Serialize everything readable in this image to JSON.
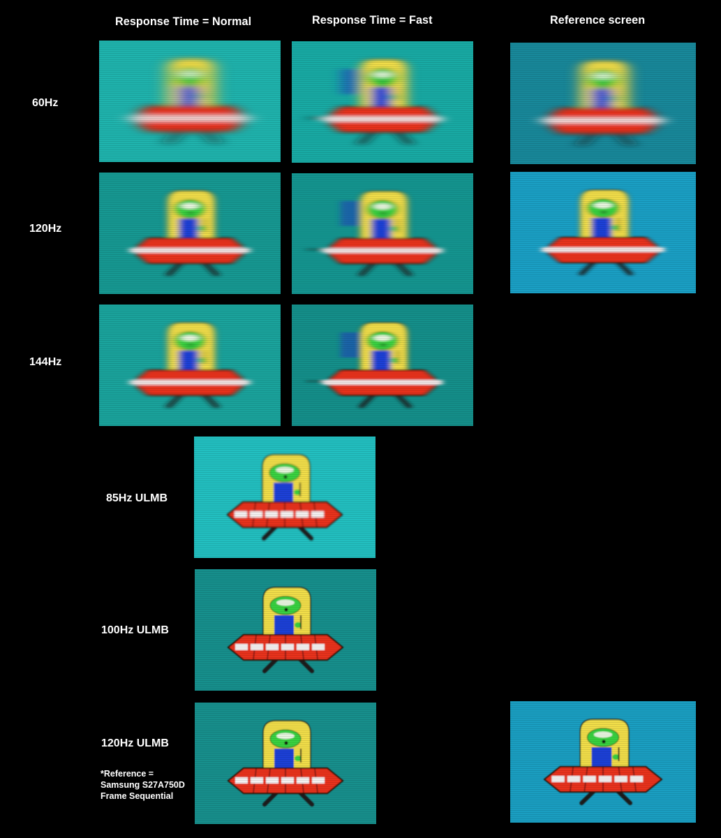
{
  "column_headers": [
    "Response Time = Normal",
    "Response Time = Fast",
    "Reference screen"
  ],
  "row_labels": {
    "hz60": "60Hz",
    "hz120": "120Hz",
    "hz144": "144Hz",
    "ulmb85": "85Hz ULMB",
    "ulmb100": "100Hz ULMB",
    "ulmb120": "120Hz ULMB"
  },
  "footnote": {
    "line1": "*Reference =",
    "line2": "Samsung S27A750D",
    "line3": "Frame Sequential"
  },
  "photos": [
    {
      "id": "60hz-normal",
      "subject": "ufo-alien",
      "bg": "#1fb3ad",
      "blur": 7,
      "trail": false,
      "sharp": false
    },
    {
      "id": "60hz-fast",
      "subject": "ufo-alien",
      "bg": "#18aaa4",
      "blur": 5,
      "trail": true,
      "sharp": false
    },
    {
      "id": "60hz-reference",
      "subject": "ufo-alien",
      "bg": "#18889a",
      "blur": 6,
      "trail": false,
      "sharp": false
    },
    {
      "id": "120hz-normal",
      "subject": "ufo-alien",
      "bg": "#169892",
      "blur": 3,
      "trail": false,
      "sharp": false
    },
    {
      "id": "120hz-fast",
      "subject": "ufo-alien",
      "bg": "#149590",
      "blur": 3,
      "trail": true,
      "sharp": false
    },
    {
      "id": "120hz-reference",
      "subject": "ufo-alien",
      "bg": "#1a9fc4",
      "blur": 2.5,
      "trail": false,
      "sharp": false
    },
    {
      "id": "144hz-normal",
      "subject": "ufo-alien",
      "bg": "#1aa39c",
      "blur": 3,
      "trail": false,
      "sharp": false
    },
    {
      "id": "144hz-fast",
      "subject": "ufo-alien",
      "bg": "#148f8a",
      "blur": 2.5,
      "trail": true,
      "sharp": false
    },
    {
      "id": "85hz-ulmb",
      "subject": "ufo-alien",
      "bg": "#22bfc0",
      "blur": 1.4,
      "trail": false,
      "sharp": true
    },
    {
      "id": "100hz-ulmb",
      "subject": "ufo-alien",
      "bg": "#168f8c",
      "blur": 0.9,
      "trail": false,
      "sharp": true
    },
    {
      "id": "120hz-ulmb",
      "subject": "ufo-alien",
      "bg": "#178f8c",
      "blur": 0.9,
      "trail": false,
      "sharp": true
    },
    {
      "id": "120hz-ulmb-reference",
      "subject": "ufo-alien",
      "bg": "#1a9ec1",
      "blur": 0.7,
      "trail": false,
      "sharp": true
    }
  ]
}
